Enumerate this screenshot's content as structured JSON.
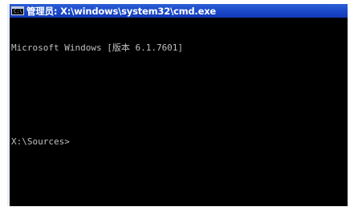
{
  "window": {
    "title": "管理员: X:\\windows\\system32\\cmd.exe",
    "icon": "cmd-icon",
    "icon_glyph": "C:\\",
    "colors": {
      "titlebar": "#1a48c9",
      "console_bg": "#000000",
      "console_text": "#c0c0c0"
    }
  },
  "console": {
    "lines": [
      "Microsoft Windows [版本 6.1.7601]",
      "",
      "",
      "X:\\Sources>"
    ]
  }
}
